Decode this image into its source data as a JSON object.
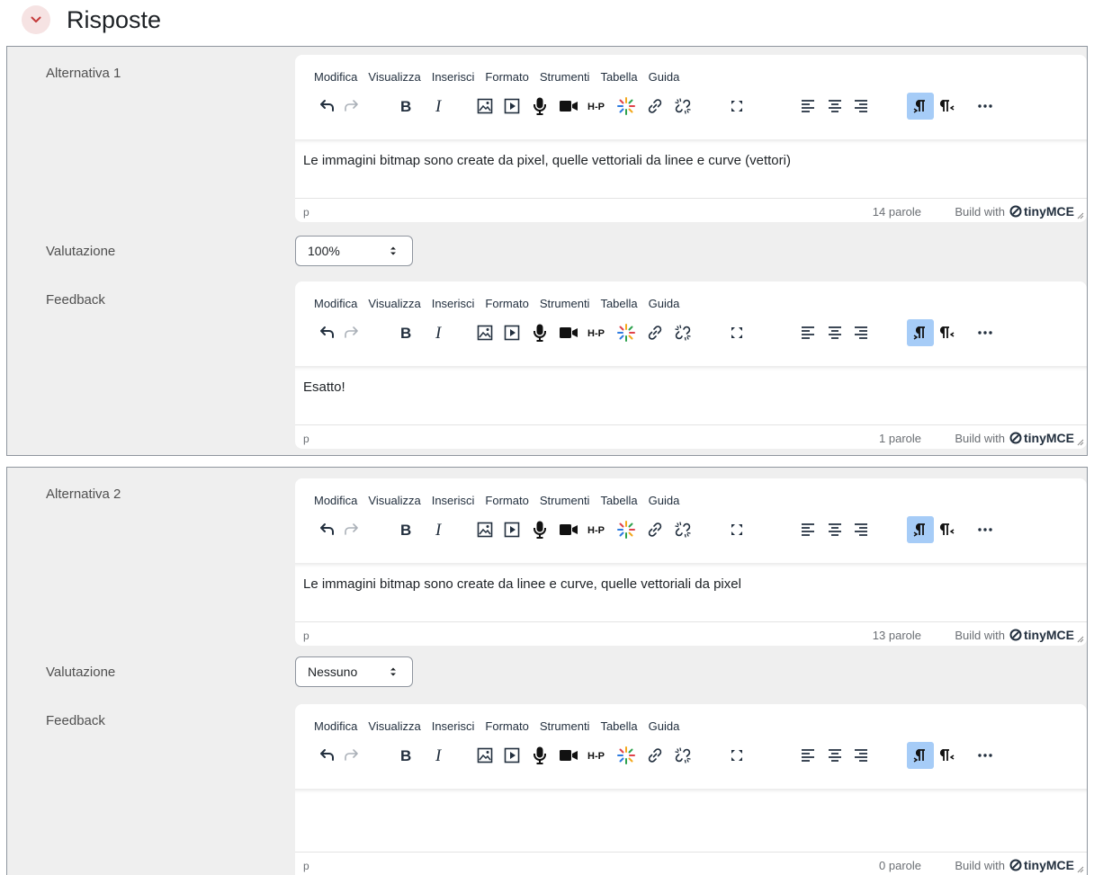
{
  "section": {
    "title": "Risposte"
  },
  "menu": [
    "Modifica",
    "Visualizza",
    "Inserisci",
    "Formato",
    "Strumenti",
    "Tabella",
    "Guida"
  ],
  "toolbar_icons": [
    "undo-icon",
    "redo-icon",
    "bold-icon",
    "italic-icon",
    "image-icon",
    "media-icon",
    "record-audio-icon",
    "record-video-icon",
    "h5p-icon",
    "ai-generate-icon",
    "link-icon",
    "unlink-icon",
    "fullscreen-icon",
    "align-left-icon",
    "align-center-icon",
    "align-right-icon",
    "ltr-icon",
    "rtl-icon",
    "more-icon"
  ],
  "status": {
    "path": "p",
    "brand_prefix": "Build with",
    "brand_name": "tinyMCE"
  },
  "answers": [
    {
      "label": "Alternativa 1",
      "text": "Le immagini bitmap sono create da pixel, quelle vettoriali da linee e curve (vettori)",
      "words": "14 parole",
      "grade_label": "Valutazione",
      "grade_value": "100%",
      "feedback_label": "Feedback",
      "feedback_text": "Esatto!",
      "feedback_words": "1 parole"
    },
    {
      "label": "Alternativa 2",
      "text": "Le immagini bitmap sono create da linee e curve, quelle vettoriali da pixel",
      "words": "13 parole",
      "grade_label": "Valutazione",
      "grade_value": "Nessuno",
      "feedback_label": "Feedback",
      "feedback_text": "",
      "feedback_words": "0 parole"
    }
  ]
}
